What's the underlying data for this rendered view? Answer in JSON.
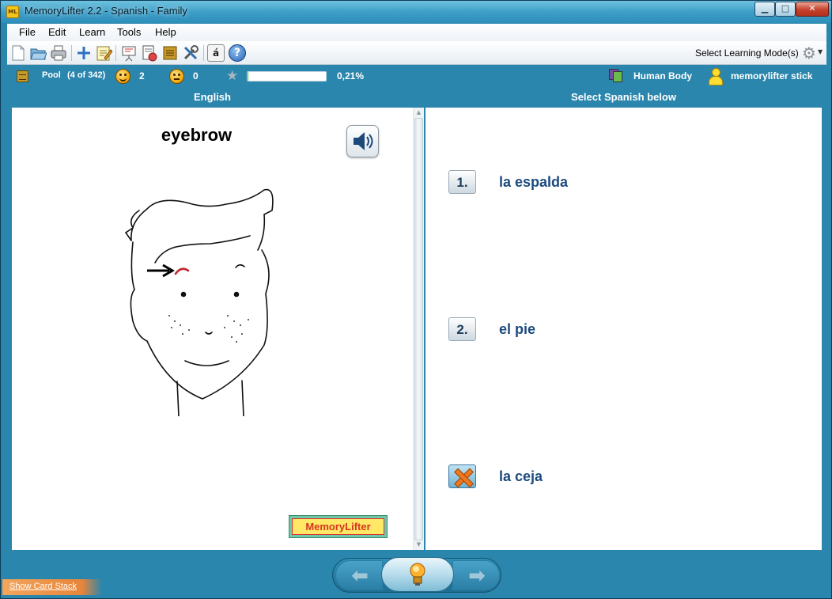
{
  "window": {
    "app_icon_text": "ML",
    "title": "MemoryLifter 2.2 - Spanish - Family",
    "minimize_glyph": "▁",
    "maximize_glyph": "□",
    "close_glyph": "✕"
  },
  "menu": {
    "items": [
      "File",
      "Edit",
      "Learn",
      "Tools",
      "Help"
    ]
  },
  "toolbar": {
    "icons": [
      "new-document-icon",
      "open-folder-icon",
      "print-icon",
      "add-card-icon",
      "edit-card-icon",
      "presentation-icon",
      "card-style-icon",
      "card-box-icon",
      "settings-tools-icon",
      "special-characters-icon",
      "help-icon"
    ],
    "special_char_glyph": "á",
    "help_glyph": "?",
    "add_glyph": "+",
    "learning_mode_label": "Select Learning Mode(s)",
    "gear_glyph": "⚙",
    "dropdown_glyph": "▼"
  },
  "status": {
    "pool_label": "Pool",
    "pool_count": "(4 of 342)",
    "correct_count": "2",
    "wrong_count": "0",
    "star_glyph": "★",
    "progress_percent": "0,21%",
    "progress_value": 0.21,
    "category": "Human Body",
    "user": "memorylifter stick"
  },
  "columns": {
    "question_header": "English",
    "answer_header": "Select Spanish below"
  },
  "question": {
    "word": "eyebrow",
    "scroll_up": "▲",
    "scroll_down": "▼",
    "logo_text": "MemoryLifter"
  },
  "answers": [
    {
      "number": "1.",
      "text": "la espalda",
      "state": "normal"
    },
    {
      "number": "2.",
      "text": "el pie",
      "state": "normal"
    },
    {
      "number": "",
      "text": "la ceja",
      "state": "wrong"
    }
  ],
  "navigation": {
    "prev_glyph": "⬅",
    "next_glyph": "➡",
    "show_card_stack": "Show Card Stack"
  },
  "colors": {
    "accent": "#2a86ad",
    "answer_text": "#1b4a7e",
    "progress_fill": "#3dbb3d",
    "eyebrow_highlight": "#c0282d"
  }
}
